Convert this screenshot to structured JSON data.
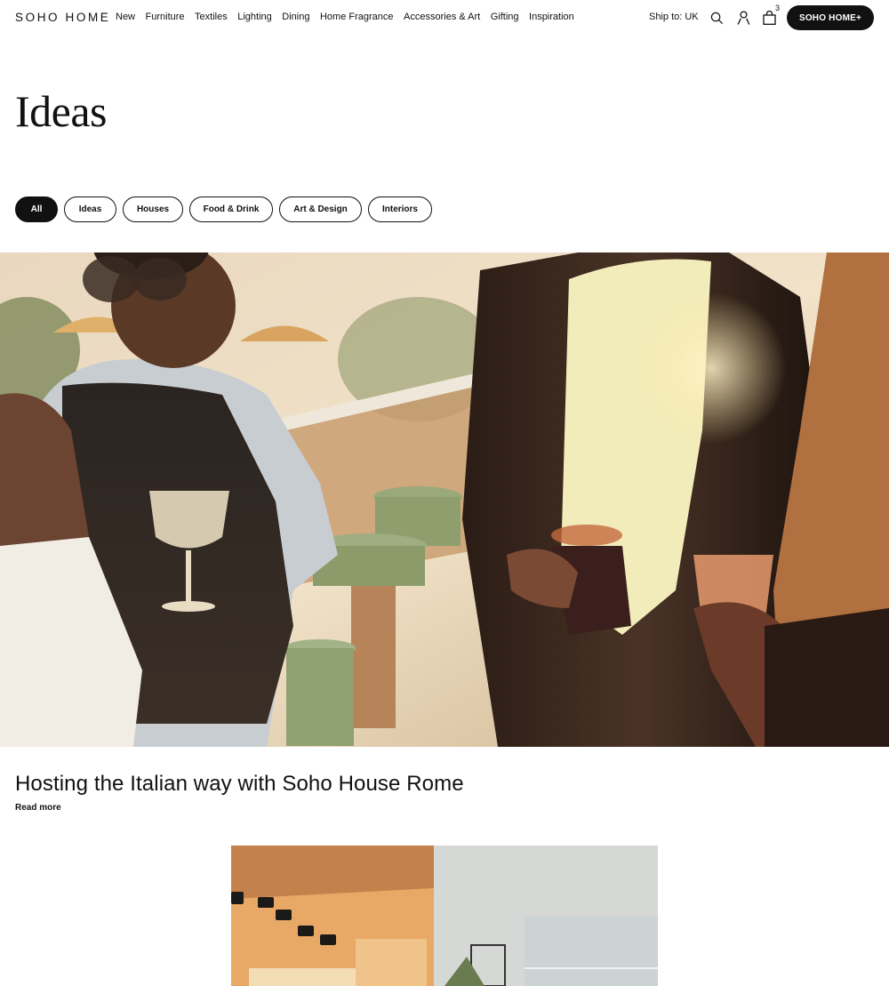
{
  "brand": {
    "logo": "SOHO HOME"
  },
  "nav": {
    "items": [
      "New",
      "Furniture",
      "Textiles",
      "Lighting",
      "Dining",
      "Home Fragrance",
      "Accessories & Art",
      "Gifting",
      "Inspiration"
    ]
  },
  "header": {
    "ship_to": "Ship to: UK",
    "bag_count": "3",
    "cta_label": "SOHO HOME+"
  },
  "icons": {
    "search": "search-icon",
    "account": "user-icon",
    "bag": "bag-icon"
  },
  "page": {
    "title": "Ideas"
  },
  "filters": [
    {
      "label": "All",
      "active": true
    },
    {
      "label": "Ideas",
      "active": false
    },
    {
      "label": "Houses",
      "active": false
    },
    {
      "label": "Food & Drink",
      "active": false
    },
    {
      "label": "Art & Design",
      "active": false
    },
    {
      "label": "Interiors",
      "active": false
    }
  ],
  "featured": {
    "title": "Hosting the Italian way with Soho House Rome",
    "link_label": "Read more"
  },
  "colors": {
    "accent": "#111111",
    "background": "#ffffff"
  }
}
